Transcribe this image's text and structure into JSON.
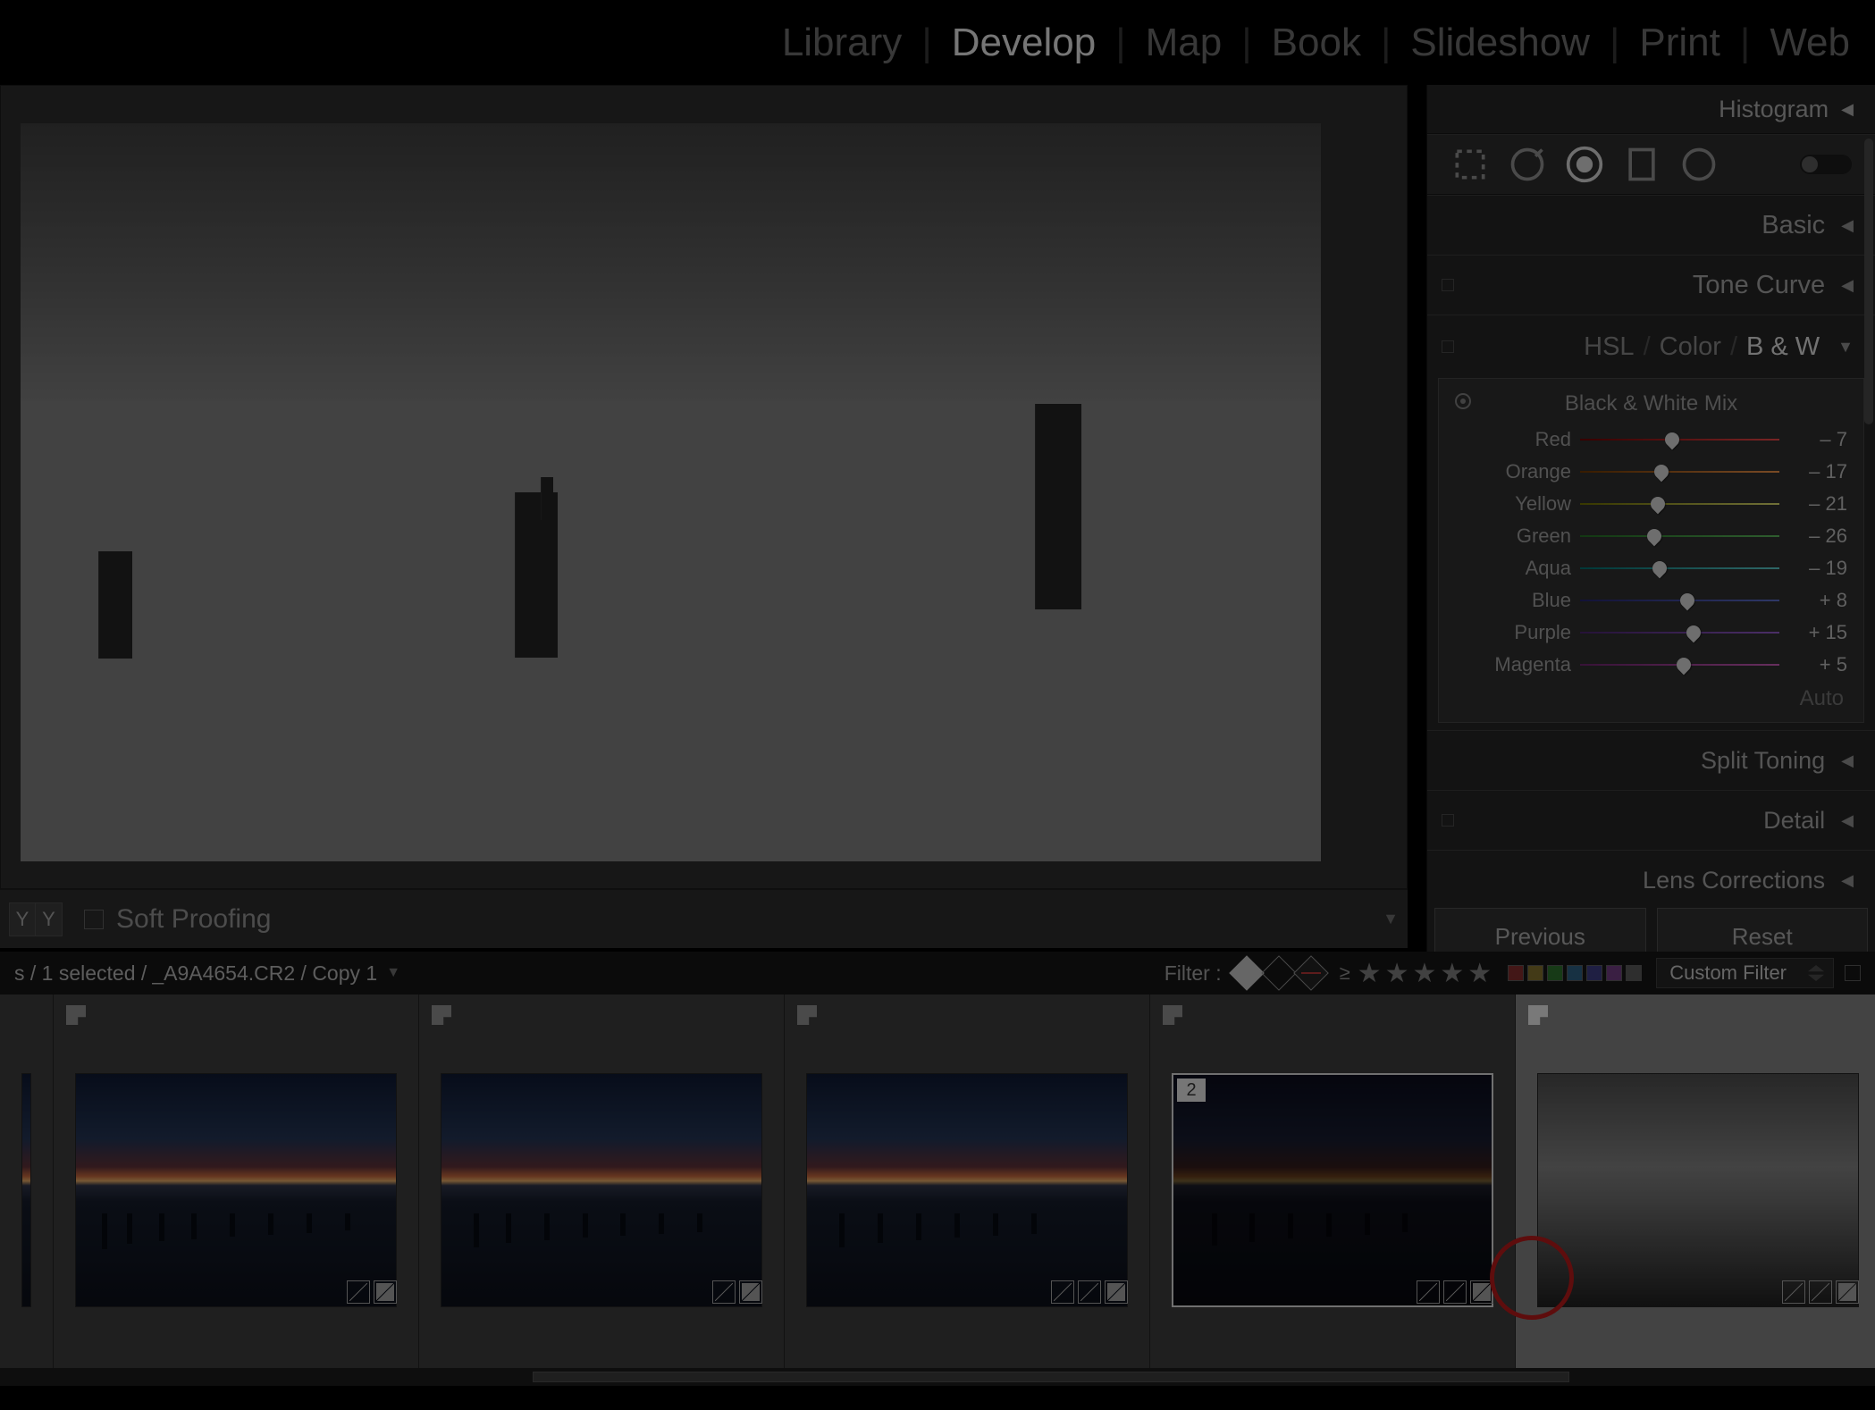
{
  "module_nav": {
    "tabs": [
      "Library",
      "Develop",
      "Map",
      "Book",
      "Slideshow",
      "Print",
      "Web"
    ],
    "active": "Develop"
  },
  "toolbar": {
    "soft_proofing_label": "Soft Proofing"
  },
  "right_pane": {
    "histogram_label": "Histogram",
    "panels": {
      "basic": "Basic",
      "tone_curve": "Tone Curve",
      "hsl": {
        "hsl": "HSL",
        "color": "Color",
        "bw": "B & W",
        "active": "bw"
      },
      "bw_mix": {
        "title": "Black & White Mix",
        "rows": [
          {
            "label": "Red",
            "value": "– 7",
            "pct": 46
          },
          {
            "label": "Orange",
            "value": "– 17",
            "pct": 41
          },
          {
            "label": "Yellow",
            "value": "– 21",
            "pct": 39
          },
          {
            "label": "Green",
            "value": "– 26",
            "pct": 37
          },
          {
            "label": "Aqua",
            "value": "– 19",
            "pct": 40
          },
          {
            "label": "Blue",
            "value": "+ 8",
            "pct": 54
          },
          {
            "label": "Purple",
            "value": "+ 15",
            "pct": 57
          },
          {
            "label": "Magenta",
            "value": "+ 5",
            "pct": 52
          }
        ],
        "auto": "Auto"
      },
      "split_toning": "Split Toning",
      "detail": "Detail",
      "lens_corrections": "Lens Corrections"
    },
    "prev_btn": "Previous",
    "reset_btn": "Reset"
  },
  "info_bar": {
    "selection_text": "s / 1 selected /",
    "filename": "_A9A4654.CR2 / Copy 1",
    "filter_label": "Filter :",
    "custom_filter": "Custom Filter",
    "color_swatches": [
      "#7a2a2a",
      "#7a6a2a",
      "#2a6a2a",
      "#2a5a7a",
      "#3a3a7a",
      "#6a3a7a",
      "#555"
    ]
  },
  "filmstrip": {
    "thumbs": [
      {
        "kind": "partial"
      },
      {
        "kind": "sunset"
      },
      {
        "kind": "sunset"
      },
      {
        "kind": "sunset"
      },
      {
        "kind": "sunset",
        "stack": "2",
        "copy4": true
      },
      {
        "kind": "bw",
        "selected": true
      }
    ]
  }
}
